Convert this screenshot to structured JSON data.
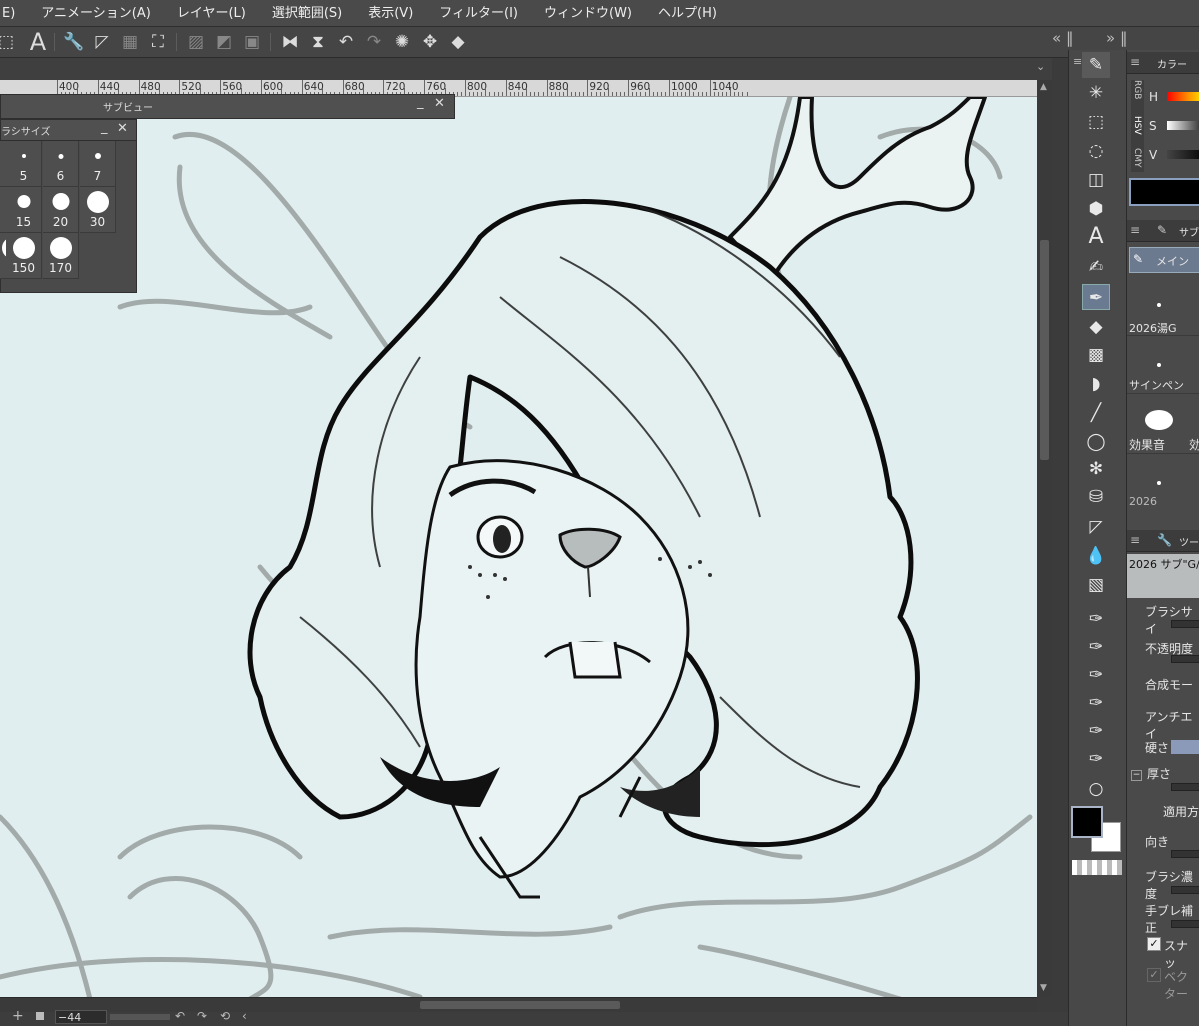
{
  "menubar": {
    "items": [
      "E)",
      "アニメーション(A)",
      "レイヤー(L)",
      "選択範囲(S)",
      "表示(V)",
      "フィルター(I)",
      "ウィンドウ(W)",
      "ヘルプ(H)"
    ]
  },
  "command_bar": {
    "icons": [
      "transform-icon",
      "text-icon",
      "wrench-icon",
      "ruler-icon",
      "grid-icon",
      "crop-icon",
      "hatch-icon",
      "fill-icon",
      "frame-icon",
      "flip-h-icon",
      "flip-v-icon",
      "undo-icon",
      "redo-icon",
      "spinner-icon",
      "move-icon",
      "bucket-icon"
    ],
    "text_icon": "A"
  },
  "ruler": {
    "labels": [
      "400",
      "440",
      "480",
      "520",
      "560",
      "600",
      "640",
      "680",
      "720",
      "760",
      "800",
      "840",
      "880",
      "920",
      "960",
      "1000",
      "1040"
    ]
  },
  "subview": {
    "title": "サブビュー"
  },
  "brush_size": {
    "title": "ラシサイズ",
    "sizes": [
      "",
      "5",
      "6",
      "7",
      "15",
      "20",
      "30",
      "150",
      "170"
    ]
  },
  "toolbox": {
    "icons": [
      "pen-tool-icon",
      "magic-wand-icon",
      "marquee-icon",
      "lasso-icon",
      "layer-icon",
      "cube-icon",
      "text-tool-icon",
      "pencil-tool-icon",
      "g-pen-icon",
      "eraser-icon",
      "blend-icon",
      "fill-tool-icon",
      "line-icon",
      "balloon-icon",
      "bug-icon",
      "spray-icon",
      "figure-icon",
      "droplet-icon",
      "gradient-icon",
      "pen1-icon",
      "pen2-icon",
      "pen3-icon",
      "pen4-icon",
      "pen5-icon",
      "pen6-icon",
      "circle-icon"
    ],
    "text_glyph": "A",
    "main_color": "#000000",
    "sub_color": "#ffffff"
  },
  "color_panel": {
    "title": "カラー",
    "tabs": [
      "RGB",
      "HSV",
      "CMY"
    ],
    "labels": [
      "H",
      "S",
      "V"
    ]
  },
  "subtool_panel": {
    "title": "サブ",
    "group": "メイン",
    "items": [
      "2026湯G",
      "サインペン",
      "効果音",
      "効",
      "2026"
    ]
  },
  "tool_property": {
    "title": "ツー",
    "preset": "2026 サブ\"G/\"",
    "rows": [
      "ブラシサイ",
      "不透明度",
      "合成モー",
      "アンチエイ",
      "硬さ",
      "厚さ",
      "適用方",
      "向き",
      "ブラシ濃度",
      "手ブレ補正",
      "スナッ",
      "ベクター"
    ]
  },
  "status": {
    "zoom": "44",
    "minus": "−"
  }
}
